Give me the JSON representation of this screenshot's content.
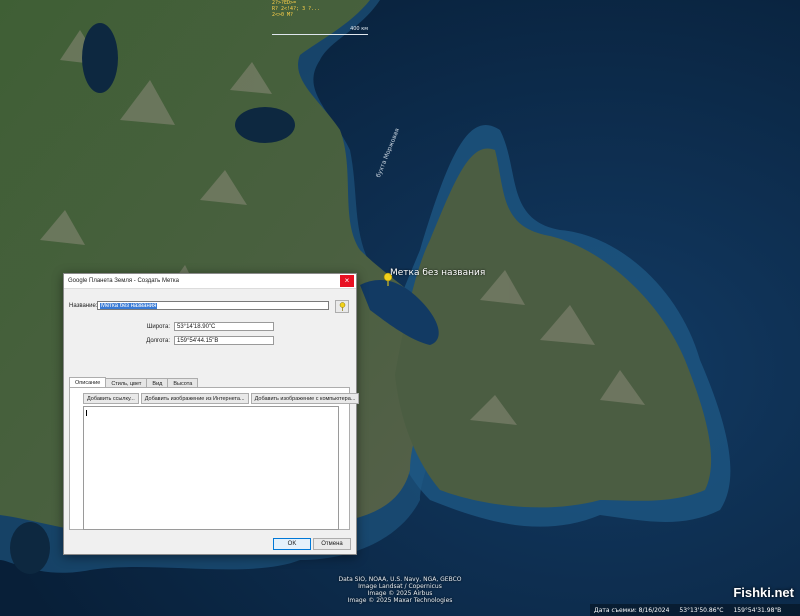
{
  "map": {
    "placemark_label": "Метка без названия",
    "bay_label": "бухта Моржовая",
    "hud_lines": [
      "2?>?ED>=",
      "R? 2<!4?; 3 ?...",
      "2<>0 M?"
    ],
    "scale_label": "400 км",
    "credits": [
      "Data SIO, NOAA, U.S. Navy, NGA, GEBCO",
      "Image Landsat / Copernicus",
      "Image © 2025 Airbus",
      "Image © 2025 Maxar Technologies"
    ],
    "status": {
      "date": "Дата съемки: 8/16/2024",
      "lat": "53°13'50.86\"С",
      "lon": "159°54'31.98\"В"
    },
    "watermark": "Fishki.net",
    "colors": {
      "ocean_deep": "#0b2a4a",
      "ocean_shallow": "#1f5a86",
      "land": "#3e5a34",
      "mountain": "#6c6a5a",
      "pin": "#f2d21b"
    }
  },
  "dialog": {
    "title": "Google Планета Земля - Создать Метка",
    "close_icon": "×",
    "name_label": "Название:",
    "name_value": "Метка без названия",
    "latitude_label": "Широта:",
    "latitude_value": "53°14'18.90\"С",
    "longitude_label": "Долгота:",
    "longitude_value": "159°54'44.15\"В",
    "tabs": [
      "Описание",
      "Стиль, цвет",
      "Вид",
      "Высота"
    ],
    "buttons": {
      "add_link": "Добавить ссылку...",
      "add_web_image": "Добавить изображение из Интернета...",
      "add_local_image": "Добавить изображение с компьютера..."
    },
    "ok": "OK",
    "cancel": "Отмена"
  }
}
